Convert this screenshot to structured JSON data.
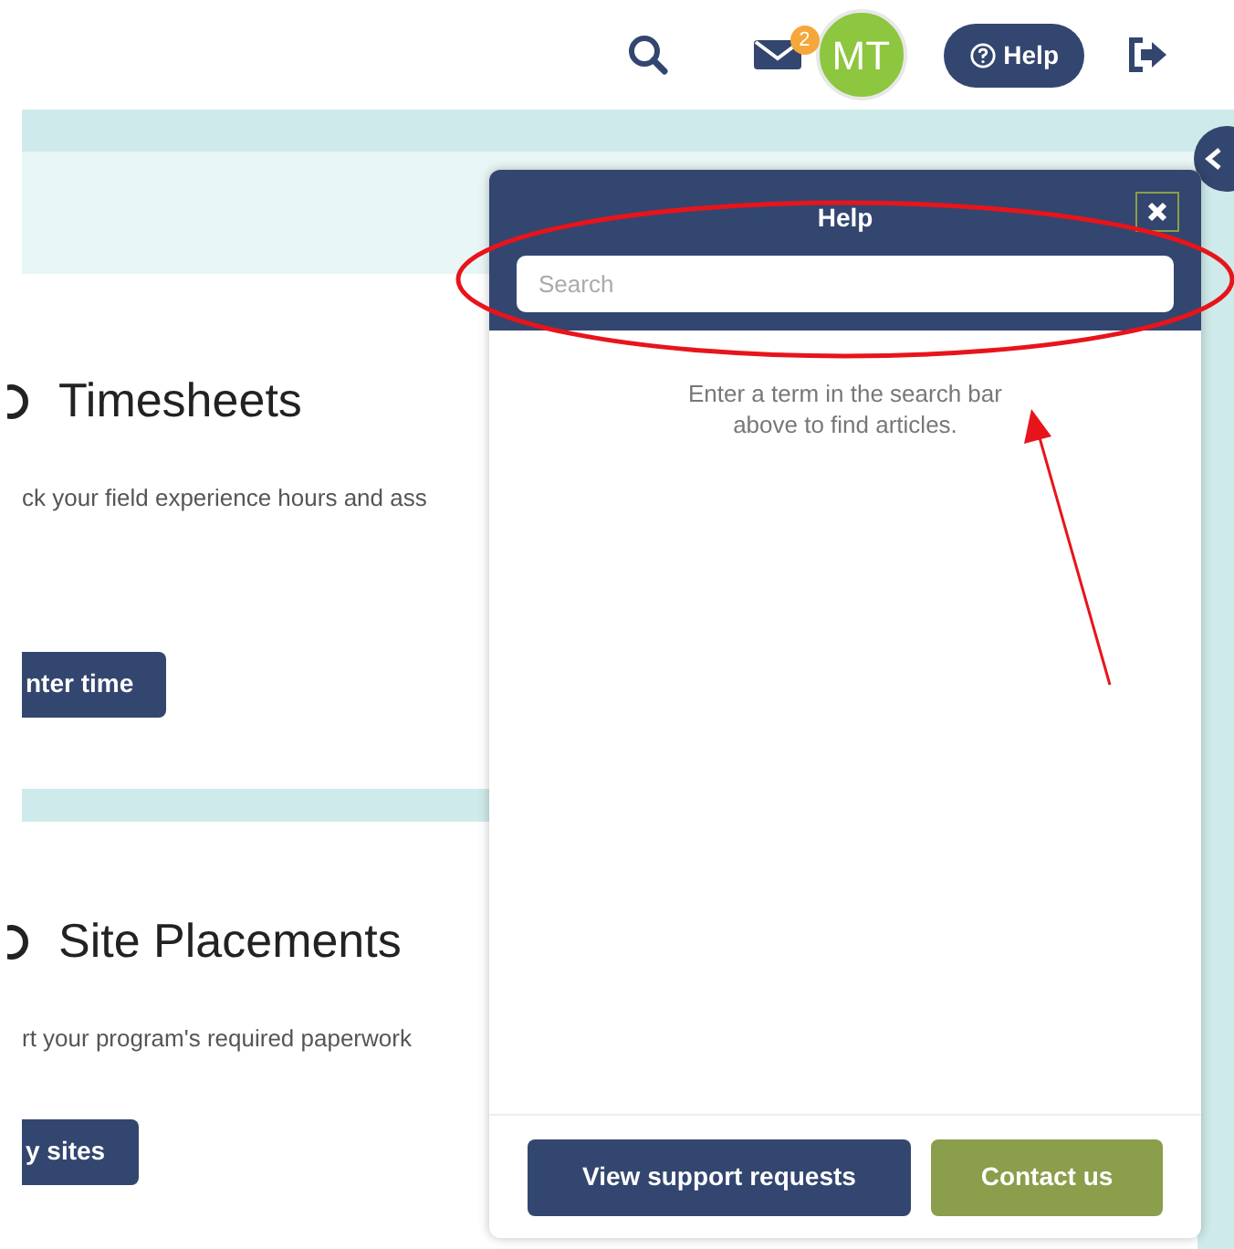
{
  "header": {
    "notification_count": "2",
    "avatar_initials": "MT",
    "help_button": "Help"
  },
  "cards": [
    {
      "title": "Timesheets",
      "description": "ck your field experience hours and ass",
      "button": "nter time"
    },
    {
      "title": "Site Placements",
      "description": "rt your program's required paperwork",
      "button": "y sites"
    }
  ],
  "help_panel": {
    "title": "Help",
    "search_placeholder": "Search",
    "message": "Enter a term in the search bar above to find articles.",
    "buttons": [
      {
        "label": "View support requests",
        "kind": "primary"
      },
      {
        "label": "Contact us",
        "kind": "secondary"
      }
    ]
  }
}
